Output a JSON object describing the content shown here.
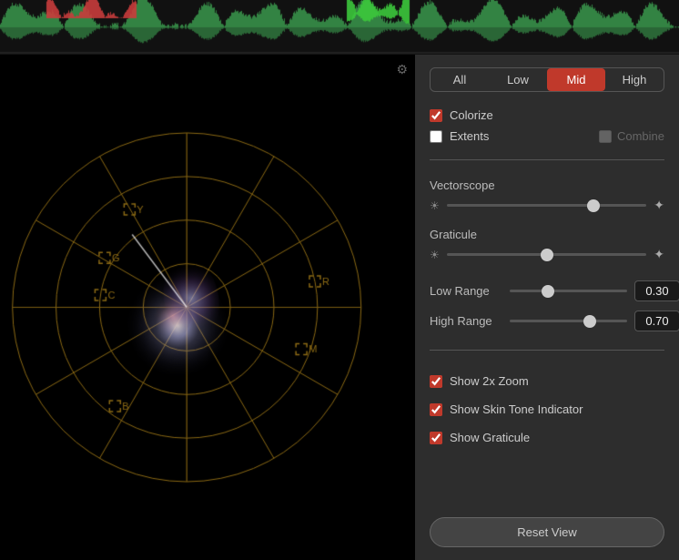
{
  "tabs": {
    "items": [
      {
        "label": "All",
        "active": false
      },
      {
        "label": "Low",
        "active": false
      },
      {
        "label": "Mid",
        "active": true
      },
      {
        "label": "High",
        "active": false
      }
    ]
  },
  "controls": {
    "colorize_label": "Colorize",
    "colorize_checked": true,
    "extents_label": "Extents",
    "extents_checked": false,
    "combine_label": "Combine",
    "combine_disabled": true,
    "vectorscope_label": "Vectorscope",
    "graticule_label": "Graticule",
    "low_range_label": "Low Range",
    "low_range_value": "0.30",
    "high_range_label": "High Range",
    "high_range_value": "0.70",
    "show_2x_zoom_label": "Show 2x Zoom",
    "show_2x_zoom_checked": true,
    "show_skin_tone_label": "Show Skin Tone Indicator",
    "show_skin_tone_checked": true,
    "show_graticule_label": "Show Graticule",
    "show_graticule_checked": true,
    "reset_label": "Reset View"
  },
  "icons": {
    "sun_small": "☀",
    "sun_large": "✦",
    "settings": "⚙"
  }
}
